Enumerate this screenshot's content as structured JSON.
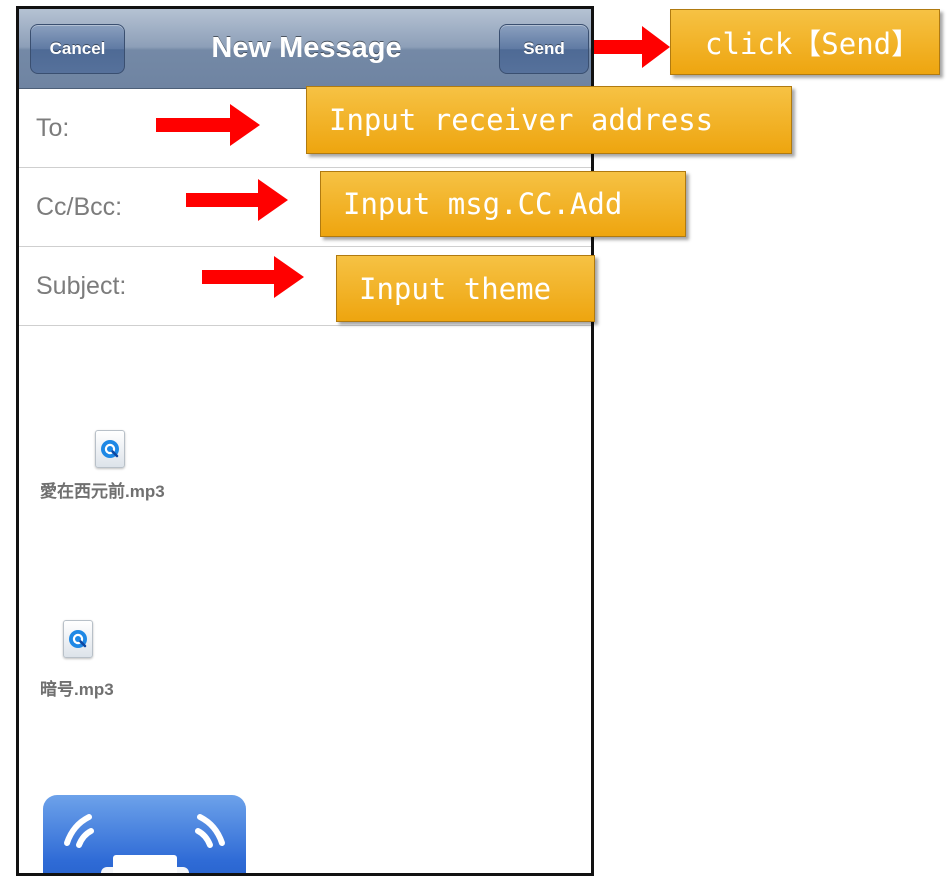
{
  "navbar": {
    "cancel_label": "Cancel",
    "title": "New Message",
    "send_label": "Send"
  },
  "fields": {
    "to_label": "To:",
    "cc_label": "Cc/Bcc:",
    "subject_label": "Subject:"
  },
  "attachments": [
    {
      "name": "愛在西元前.mp3",
      "icon": "quicktime-file-icon"
    },
    {
      "name": "暗号.mp3",
      "icon": "quicktime-file-icon"
    }
  ],
  "annotations": {
    "send": "click【Send】",
    "to": "Input receiver address",
    "cc": "Input msg.CC.Add",
    "subject": "Input theme"
  },
  "colors": {
    "arrow": "#ff0000",
    "callout": "#eea50f",
    "navbar": "#7489a6",
    "app_icon": "#2f6bd6"
  }
}
